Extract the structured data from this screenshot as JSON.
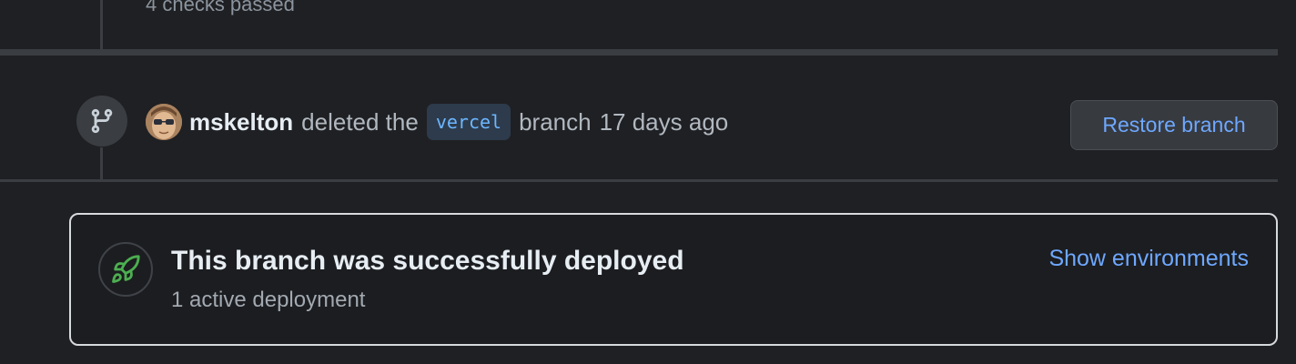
{
  "previous_event": {
    "status_text": "4 checks passed"
  },
  "branch_event": {
    "badge_icon": "git-branch-icon",
    "author": "mskelton",
    "action_prefix": "deleted the",
    "branch_name": "vercel",
    "action_suffix": "branch",
    "time_ago": "17 days ago",
    "restore_label": "Restore branch"
  },
  "deployment": {
    "icon": "rocket-icon",
    "title": "This branch was successfully deployed",
    "subtitle": "1 active deployment",
    "show_environments_label": "Show environments",
    "accent_color": "#4caf50"
  },
  "colors": {
    "background": "#1f2023",
    "link": "#6ea8ff",
    "branch_chip_bg": "#2d3b4c"
  }
}
